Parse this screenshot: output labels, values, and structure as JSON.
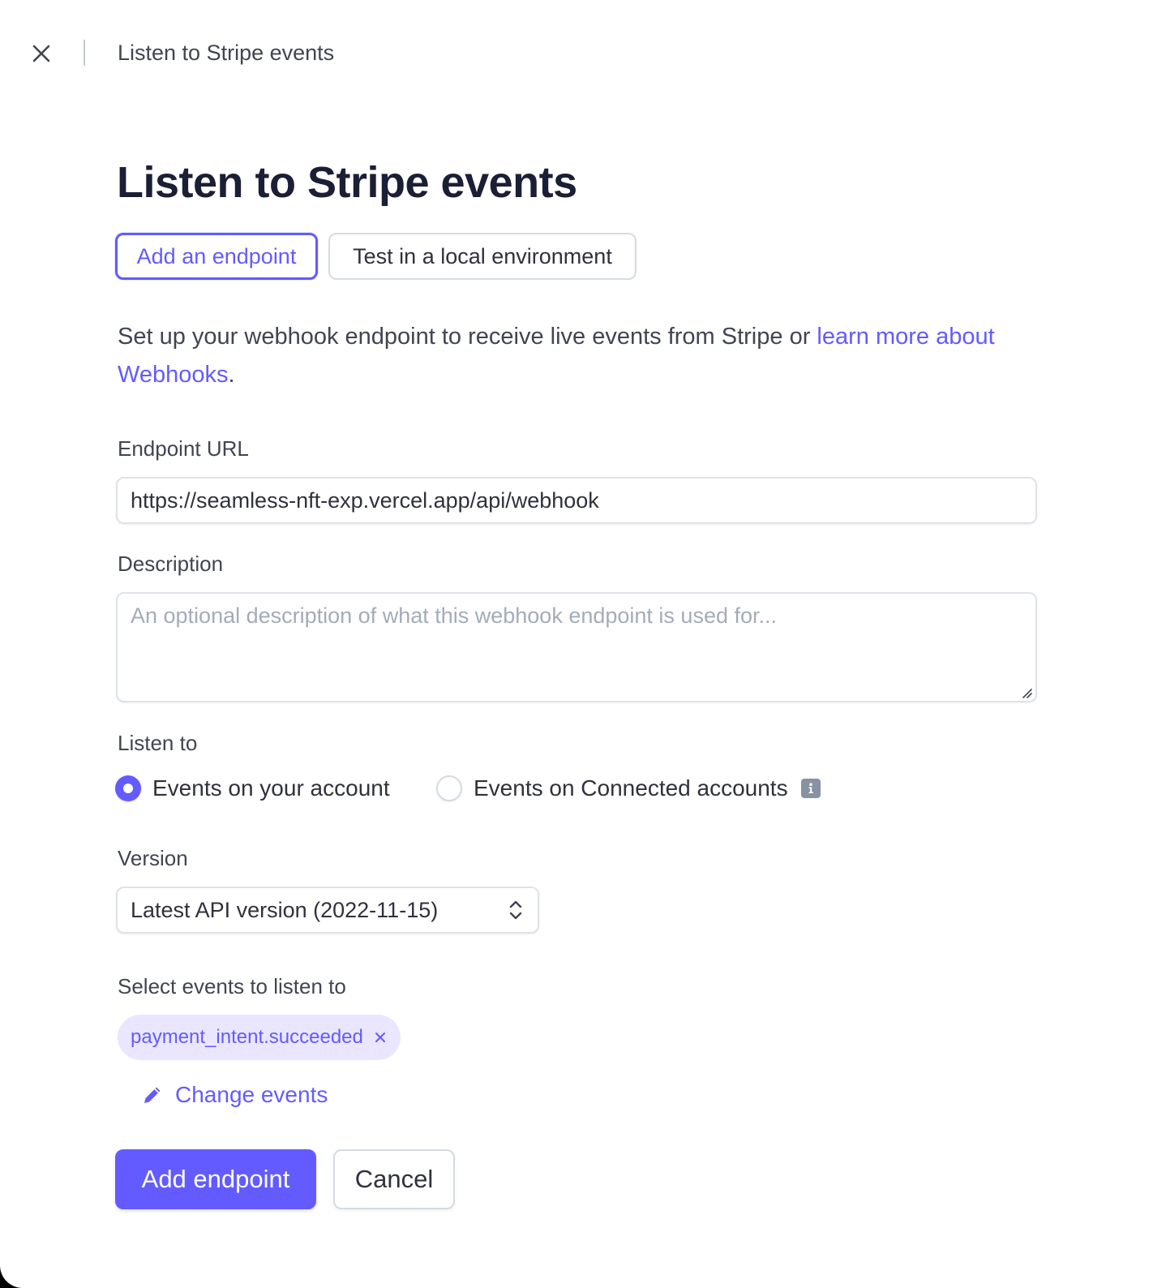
{
  "header": {
    "title": "Listen to Stripe events",
    "close_icon": "close-icon"
  },
  "page": {
    "title": "Listen to Stripe events"
  },
  "tabs": [
    {
      "label": "Add an endpoint",
      "selected": true
    },
    {
      "label": "Test in a local environment",
      "selected": false
    }
  ],
  "intro": {
    "text": "Set up your webhook endpoint to receive live events from Stripe or ",
    "link_text": "learn more about Webhooks",
    "suffix": "."
  },
  "endpoint_url": {
    "label": "Endpoint URL",
    "value": "https://seamless-nft-exp.vercel.app/api/webhook"
  },
  "description": {
    "label": "Description",
    "placeholder": "An optional description of what this webhook endpoint is used for...",
    "value": ""
  },
  "listen_to": {
    "label": "Listen to",
    "options": [
      {
        "label": "Events on your account",
        "checked": true
      },
      {
        "label": "Events on Connected accounts",
        "checked": false,
        "icon": "info-icon"
      }
    ]
  },
  "version": {
    "label": "Version",
    "selected": "Latest API version (2022-11-15)",
    "icon": "chevron-up-down-icon"
  },
  "events": {
    "label": "Select events to listen to",
    "selected": [
      "payment_intent.succeeded"
    ],
    "change_label": "Change events",
    "change_icon": "pencil-icon"
  },
  "actions": {
    "primary_label": "Add endpoint",
    "secondary_label": "Cancel"
  },
  "colors": {
    "accent": "#635bff",
    "chip_background": "#eae6ff",
    "text": "#1a1f36",
    "border": "#d5dbe1"
  }
}
